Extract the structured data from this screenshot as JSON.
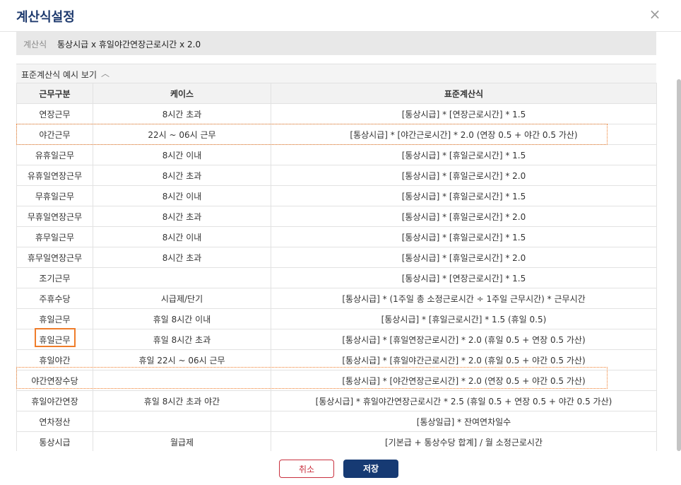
{
  "dialog": {
    "title": "계산식설정",
    "close_icon": "×"
  },
  "formula": {
    "label": "계산식",
    "value": "통상시급 x 휴일야간연장근로시간 x 2.0"
  },
  "example": {
    "label": "표준계산식 예시 보기",
    "chevron": "︿"
  },
  "table": {
    "headers": [
      "근무구분",
      "케이스",
      "표준계산식"
    ],
    "rows": [
      [
        "연장근무",
        "8시간 초과",
        "[통상시급] * [연장근로시간] * 1.5"
      ],
      [
        "야간근무",
        "22시 ~ 06시 근무",
        "[통상시급] * [야간근로시간] * 2.0 (연장 0.5 + 야간 0.5 가산)"
      ],
      [
        "유휴일근무",
        "8시간 이내",
        "[통상시급] * [휴일근로시간] * 1.5"
      ],
      [
        "유휴일연장근무",
        "8시간 초과",
        "[통상시급] * [휴일근로시간] * 2.0"
      ],
      [
        "무휴일근무",
        "8시간 이내",
        "[통상시급] * [휴일근로시간] * 1.5"
      ],
      [
        "무휴일연장근무",
        "8시간 초과",
        "[통상시급] * [휴일근로시간] * 2.0"
      ],
      [
        "휴무일근무",
        "8시간 이내",
        "[통상시급] * [휴일근로시간] * 1.5"
      ],
      [
        "휴무일연장근무",
        "8시간 초과",
        "[통상시급] * [휴일근로시간] * 2.0"
      ],
      [
        "조기근무",
        "",
        "[통상시급] * [연장근로시간] * 1.5"
      ],
      [
        "주휴수당",
        "시급제/단기",
        "[통상시급] * (1주일 총 소정근로시간 ÷ 1주일 근무시간) * 근무시간"
      ],
      [
        "휴일근무",
        "휴일 8시간 이내",
        "[통상시급] * [휴일근로시간] * 1.5 (휴일 0.5)"
      ],
      [
        "휴일근무",
        "휴일 8시간 초과",
        "[통상시급] * [휴일연장근로시간] * 2.0 (휴일 0.5 + 연장 0.5 가산)"
      ],
      [
        "휴일야간",
        "휴일 22시 ~ 06시 근무",
        "[통상시급] * [휴일야간근로시간] * 2.0 (휴일 0.5 + 야간 0.5 가산)"
      ],
      [
        "야간연장수당",
        "",
        "[통상시급] * [야간연장근로시간] * 2.0 (연장 0.5 + 야간 0.5 가산)"
      ],
      [
        "휴일야간연장",
        "휴일 8시간 초과 야간",
        "[통상시급] * 휴일야간연장근로시간 * 2.5 (휴일 0.5 + 연장 0.5 + 야간 0.5 가산)"
      ],
      [
        "연차정산",
        "",
        "[통상일급] * 잔여연차일수"
      ],
      [
        "통상시급",
        "월급제",
        "[기본급 + 통상수당 합계] / 월 소정근로시간"
      ]
    ]
  },
  "buttons": {
    "cancel": "취소",
    "save": "저장"
  },
  "colors": {
    "accent": "#163a73",
    "highlight": "#ef7d2b",
    "cancel": "#c9303e"
  }
}
